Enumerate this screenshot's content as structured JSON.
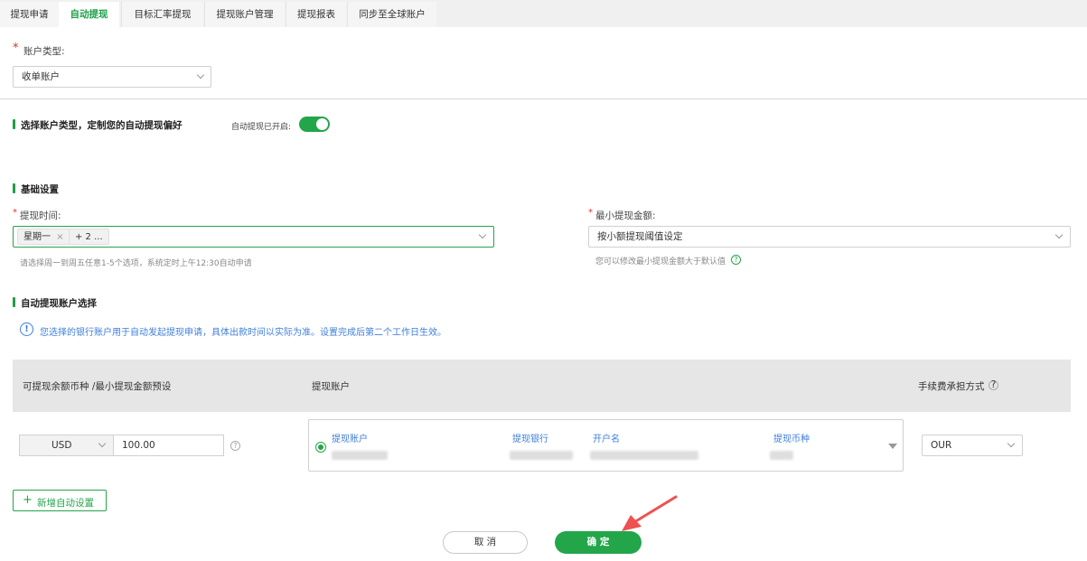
{
  "tabs": [
    {
      "label": "提现申请",
      "active": false
    },
    {
      "label": "自动提现",
      "active": true
    },
    {
      "label": "目标汇率提现",
      "active": false
    },
    {
      "label": "提现账户管理",
      "active": false
    },
    {
      "label": "提现报表",
      "active": false
    },
    {
      "label": "同步至全球账户",
      "active": false
    }
  ],
  "account_type": {
    "required_mark": "*",
    "label": "账户类型:",
    "value": "收单账户"
  },
  "auto_section": {
    "title": "选择账户类型，定制您的自动提现偏好",
    "toggle_label": "自动提现已开启:",
    "toggle_on": true
  },
  "basic": {
    "title": "基础设置",
    "time_label": "提现时间:",
    "time_tags": [
      "星期一",
      "+ 2 ..."
    ],
    "tag_close": "×",
    "time_hint": "请选择周一到周五任意1-5个选项，系统定时上午12:30自动申请",
    "min_label": "最小提现金额:",
    "min_value": "按小额提现阈值设定",
    "min_hint": "您可以修改最小提现金额大于默认值"
  },
  "accounts": {
    "title": "自动提现账户选择",
    "info_icon": "!",
    "info": "您选择的银行账户用于自动发起提现申请，具体出款时间以实际为准。设置完成后第二个工作日生效。",
    "col_currency": "可提现余额币种 /最小提现金额预设",
    "col_account": "提现账户",
    "col_fee": "手续费承担方式",
    "help_glyph": "?",
    "row": {
      "currency": "USD",
      "amount": "100.00",
      "acct_headers": [
        "提现账户",
        "提现银行",
        "开户名",
        "提现币种"
      ],
      "fee_mode": "OUR"
    },
    "add_label": "新增自动设置",
    "add_icon": "+"
  },
  "footer": {
    "cancel": "取 消",
    "confirm": "确 定"
  },
  "colors": {
    "accent": "#20a04a",
    "info": "#3f7fd9",
    "annotation_arrow": "#f05050"
  }
}
